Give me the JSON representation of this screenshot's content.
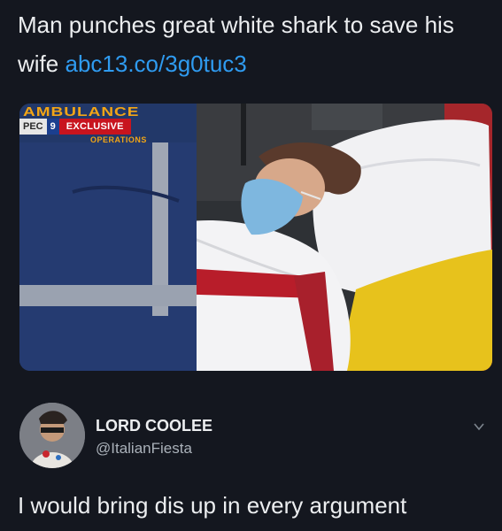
{
  "tweet": {
    "text": "Man punches great white shark to save his wife",
    "link": "abc13.co/3g0tuc3"
  },
  "media": {
    "vest_text": "AMBULANCE",
    "vest_sub": "OPERATIONS",
    "badge_prefix": "PEC",
    "badge_logo": "9",
    "badge_label": "EXCLUSIVE"
  },
  "reply": {
    "display_name": "LORD COOLEE",
    "handle": "@ItalianFiesta",
    "text": "I would bring dis up in every argument"
  },
  "icons": {
    "more": "chevron-down-icon"
  }
}
